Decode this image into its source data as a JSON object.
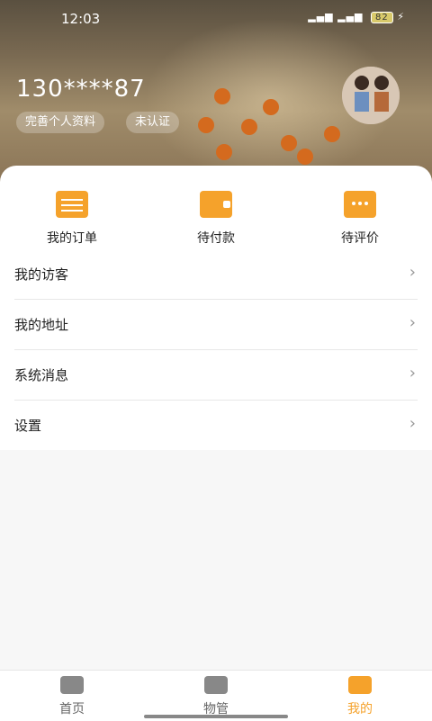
{
  "status": {
    "time": "12:03",
    "battery": "82"
  },
  "profile": {
    "phone": "130****87",
    "complete_profile": "完善个人资料",
    "verify_status": "未认证"
  },
  "quick_actions": [
    {
      "label": "我的订单",
      "icon": "order-clipboard-icon"
    },
    {
      "label": "待付款",
      "icon": "wallet-icon"
    },
    {
      "label": "待评价",
      "icon": "comment-icon"
    }
  ],
  "menu": [
    {
      "label": "我的访客"
    },
    {
      "label": "我的地址"
    },
    {
      "label": "系统消息"
    },
    {
      "label": "设置"
    }
  ],
  "tabs": [
    {
      "label": "首页",
      "icon": "home-icon"
    },
    {
      "label": "物管",
      "icon": "box-icon"
    },
    {
      "label": "我的",
      "icon": "user-icon",
      "active": true
    }
  ],
  "colors": {
    "accent": "#f5a22b"
  }
}
